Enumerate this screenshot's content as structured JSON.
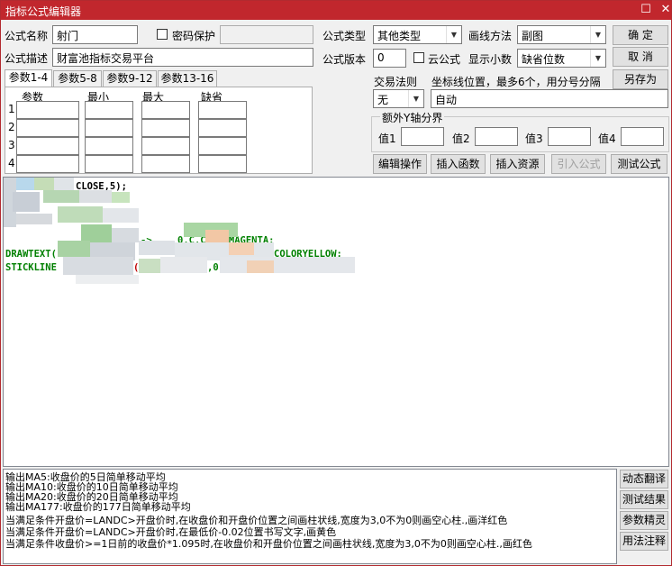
{
  "window": {
    "title": "指标公式编辑器",
    "restore_glyph": "☐",
    "close_glyph": "✕"
  },
  "form": {
    "name_label": "公式名称",
    "name_value": "射门",
    "password_label": "密码保护",
    "desc_label": "公式描述",
    "desc_value": "财富池指标交易平台",
    "type_label": "公式类型",
    "type_value": "其他类型",
    "draw_label": "画线方法",
    "draw_value": "副图",
    "version_label": "公式版本",
    "version_value": "0",
    "cloud_label": "云公式",
    "decimals_label": "显示小数",
    "decimals_value": "缺省位数",
    "trade_rule_label": "交易法则",
    "trade_rule_value": "无",
    "coord_label": "坐标线位置，最多6个，用分号分隔",
    "coord_value": "自动",
    "yaxis_group_label": "额外Y轴分界",
    "yaxis_labels": [
      "值1",
      "值2",
      "值3",
      "值4"
    ]
  },
  "buttons": {
    "ok": "确 定",
    "cancel": "取 消",
    "save_as": "另存为",
    "edit_op": "编辑操作",
    "insert_func": "插入函数",
    "insert_res": "插入资源",
    "import_formula": "引入公式",
    "test_formula": "测试公式"
  },
  "param_tabs": [
    "参数1-4",
    "参数5-8",
    "参数9-12",
    "参数13-16"
  ],
  "param_headers": [
    "参数",
    "最小",
    "最大",
    "缺省"
  ],
  "param_rows": [
    "1",
    "2",
    "3",
    "4"
  ],
  "editor": {
    "line1": "CLOSE,5);",
    "line5": "0,C,COLORMAGENTA;",
    "line6a": "DRAWTEXT(",
    "line6b": "COLORYELLOW;",
    "line7a": "STICKLINE",
    "line7b": "(C,1)",
    "line7c": ",0,0",
    "arrow": "->"
  },
  "output_lines": [
    "输出MA5:收盘价的5日简单移动平均",
    "输出MA10:收盘价的10日简单移动平均",
    "输出MA20:收盘价的20日简单移动平均",
    "输出MA177:收盘价的177日简单移动平均",
    "当满足条件开盘价=LANDC>开盘价时,在收盘价和开盘价位置之间画柱状线,宽度为3,0不为0则画空心柱.,画洋红色",
    "当满足条件开盘价=LANDC>开盘价时,在最低价-0.02位置书写文字,画黄色",
    "当满足条件收盘价>=1日前的收盘价*1.095时,在收盘价和开盘价位置之间画柱状线,宽度为3,0不为0则画空心柱.,画红色"
  ],
  "side_buttons": [
    "动态翻译",
    "测试结果",
    "参数精灵",
    "用法注释"
  ],
  "colors": {
    "title_bar": "#c1272d",
    "code_green": "#008000",
    "code_red": "#c00000"
  }
}
